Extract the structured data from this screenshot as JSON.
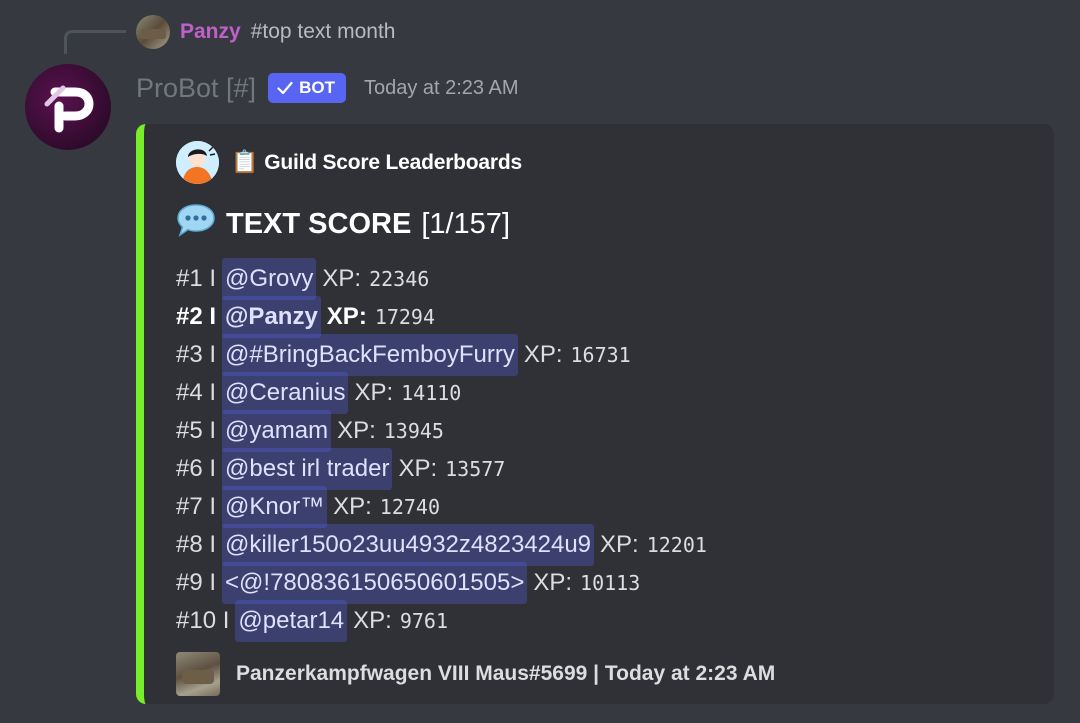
{
  "reply": {
    "username": "Panzy",
    "content": "#top text month",
    "avatar_icon": "tank-avatar-icon"
  },
  "message": {
    "author": "ProBot [#]",
    "badge": "BOT",
    "badge_icon": "checkmark-icon",
    "timestamp": "Today at 2:23 AM",
    "avatar_icon": "probot-logo-icon"
  },
  "embed": {
    "accent_color": "#77ee29",
    "author_name": "Guild Score Leaderboards",
    "author_emoji": "📋",
    "title_emoji": "💬",
    "title_main": "TEXT SCORE",
    "title_page": "[1/157]",
    "xp_label": "XP:",
    "rows": [
      {
        "rank": "#1 I",
        "user": "@Grovy",
        "xp": "22346"
      },
      {
        "rank": "#2 I",
        "user": "@Panzy",
        "xp": "17294"
      },
      {
        "rank": "#3 I",
        "user": "@#BringBackFemboyFurry",
        "xp": "16731"
      },
      {
        "rank": "#4 I",
        "user": "@Ceranius",
        "xp": "14110"
      },
      {
        "rank": "#5 I",
        "user": "@yamam",
        "xp": "13945"
      },
      {
        "rank": "#6 I",
        "user": "@best irl trader",
        "xp": "13577"
      },
      {
        "rank": "#7 I",
        "user": "@Knor™",
        "xp": "12740"
      },
      {
        "rank": "#8 I",
        "user": "@killer150o23uu4932z4823424u9",
        "xp": "12201"
      },
      {
        "rank": "#9 I",
        "user": "<@!780836150650601505>",
        "xp": "10113"
      },
      {
        "rank": "#10 I",
        "user": "@petar14",
        "xp": "9761"
      }
    ],
    "footer_text": "Panzerkampfwagen VIII Maus#5699 | Today at 2:23 AM"
  },
  "colors": {
    "background": "#36393f",
    "embed_bg": "#2f3136",
    "mention_bg": "#5865f24d",
    "reply_user": "#c061cb",
    "bot_badge": "#5865f2"
  }
}
